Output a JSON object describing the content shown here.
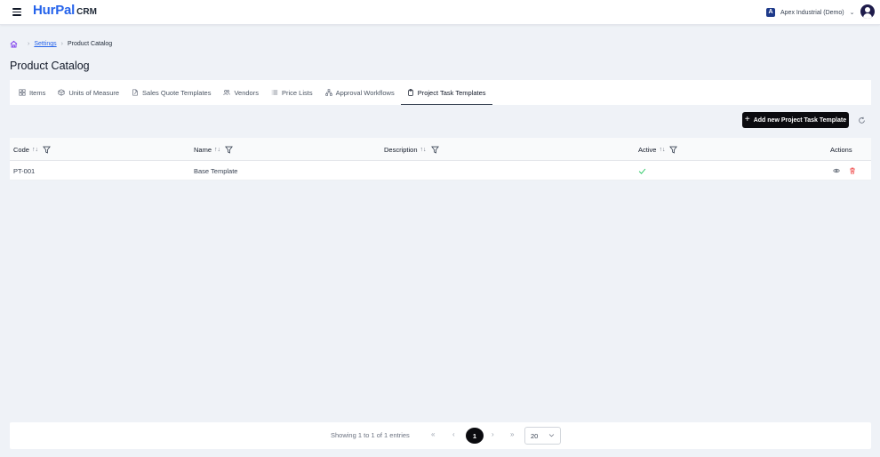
{
  "header": {
    "logo_main": "HurPal",
    "logo_sub": "CRM",
    "company_name": "Apex Industrial (Demo)",
    "company_initial": "A"
  },
  "breadcrumb": {
    "parent": "Settings",
    "current": "Product Catalog"
  },
  "page": {
    "title": "Product Catalog"
  },
  "tabs": [
    {
      "label": "Items",
      "icon": "grid-icon"
    },
    {
      "label": "Units of Measure",
      "icon": "box-icon"
    },
    {
      "label": "Sales Quote Templates",
      "icon": "file-edit-icon"
    },
    {
      "label": "Vendors",
      "icon": "users-icon"
    },
    {
      "label": "Price Lists",
      "icon": "list-icon"
    },
    {
      "label": "Approval Workflows",
      "icon": "workflow-icon"
    },
    {
      "label": "Project Task Templates",
      "icon": "clipboard-icon",
      "active": true
    }
  ],
  "toolbar": {
    "add_label": "Add new Project Task Template"
  },
  "table": {
    "columns": {
      "code": "Code",
      "name": "Name",
      "description": "Description",
      "active": "Active",
      "actions": "Actions"
    },
    "sort_glyph": "↑↓",
    "rows": [
      {
        "code": "PT-001",
        "name": "Base Template",
        "description": "",
        "active": true
      }
    ]
  },
  "pagination": {
    "info": "Showing 1 to 1 of 1 entries",
    "first": "«",
    "prev": "‹",
    "current_page": "1",
    "next": "›",
    "last": "»",
    "page_size": "20"
  },
  "colors": {
    "brand": "#2563eb",
    "primary_button": "#0b0b0f",
    "active_check": "#22c55e",
    "delete": "#ef4444",
    "home_icon": "#7c3aed"
  }
}
